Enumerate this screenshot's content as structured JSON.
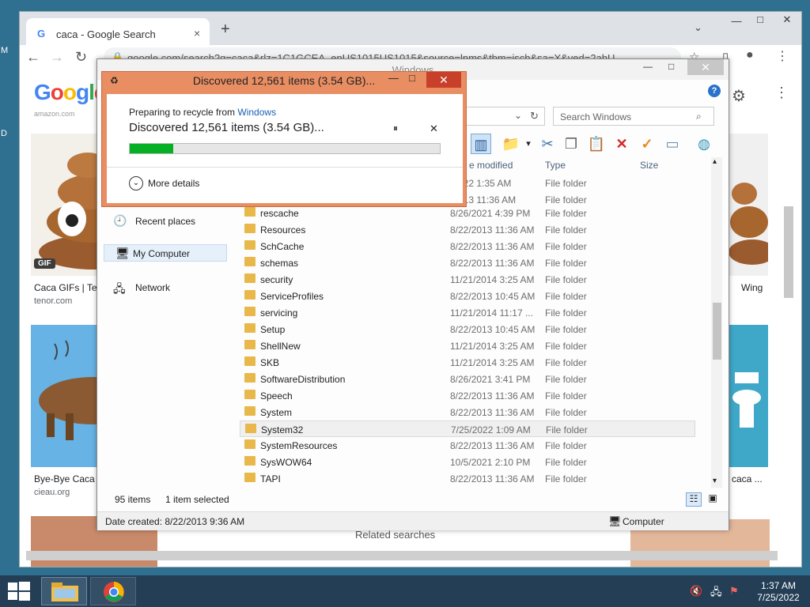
{
  "desktop": {
    "edge_m": "M",
    "edge_d": "D"
  },
  "chrome": {
    "tab_title": "caca - Google Search",
    "tab_close": "×",
    "new_tab": "+",
    "tab_menu": "⌄",
    "url": "google.com/search?q=caca&rlz=1C1GCEA_enUS1015US1015&source=lnms&tbm=isch&sa=X&ved=2ahU",
    "logo": "Google",
    "results": [
      {
        "caption": "Caca GIFs | Te",
        "source": "tenor.com",
        "badge": "GIF"
      },
      {
        "caption": "Bye-Bye Caca -",
        "source": "cieau.org"
      },
      {
        "caption": "Wing",
        "source": ""
      },
      {
        "caption": "caca ...",
        "source": ""
      }
    ],
    "related": "Related searches",
    "amazon_snip": "amazon.com"
  },
  "explorer": {
    "title": "Windows",
    "search_placeholder": "Search Windows",
    "columns": {
      "modified": "e modified",
      "type": "Type",
      "size": "Size"
    },
    "nav": [
      {
        "label": "Recent places",
        "icon": "recent-places-icon"
      },
      {
        "label": "My Computer",
        "icon": "computer-icon"
      },
      {
        "label": "Network",
        "icon": "network-icon"
      }
    ],
    "partial_rows": [
      {
        "date": "/2022 1:35 AM",
        "type": "File folder"
      },
      {
        "date": "/2013 11:36 AM",
        "type": "File folder"
      }
    ],
    "files": [
      {
        "name": "rescache",
        "date": "8/26/2021 4:39 PM",
        "type": "File folder"
      },
      {
        "name": "Resources",
        "date": "8/22/2013 11:36 AM",
        "type": "File folder"
      },
      {
        "name": "SchCache",
        "date": "8/22/2013 11:36 AM",
        "type": "File folder"
      },
      {
        "name": "schemas",
        "date": "8/22/2013 11:36 AM",
        "type": "File folder"
      },
      {
        "name": "security",
        "date": "11/21/2014 3:25 AM",
        "type": "File folder"
      },
      {
        "name": "ServiceProfiles",
        "date": "8/22/2013 10:45 AM",
        "type": "File folder"
      },
      {
        "name": "servicing",
        "date": "11/21/2014 11:17 ...",
        "type": "File folder"
      },
      {
        "name": "Setup",
        "date": "8/22/2013 10:45 AM",
        "type": "File folder"
      },
      {
        "name": "ShellNew",
        "date": "11/21/2014 3:25 AM",
        "type": "File folder"
      },
      {
        "name": "SKB",
        "date": "11/21/2014 3:25 AM",
        "type": "File folder"
      },
      {
        "name": "SoftwareDistribution",
        "date": "8/26/2021 3:41 PM",
        "type": "File folder"
      },
      {
        "name": "Speech",
        "date": "8/22/2013 11:36 AM",
        "type": "File folder"
      },
      {
        "name": "System",
        "date": "8/22/2013 11:36 AM",
        "type": "File folder"
      },
      {
        "name": "System32",
        "date": "7/25/2022 1:09 AM",
        "type": "File folder",
        "selected": true
      },
      {
        "name": "SystemResources",
        "date": "8/22/2013 11:36 AM",
        "type": "File folder"
      },
      {
        "name": "SysWOW64",
        "date": "10/5/2021 2:10 PM",
        "type": "File folder"
      },
      {
        "name": "TAPI",
        "date": "8/22/2013 11:36 AM",
        "type": "File folder"
      }
    ],
    "status": {
      "count": "95 items",
      "selected": "1 item selected"
    },
    "details": {
      "date_created": "Date created: 8/22/2013 9:36 AM",
      "location": "Computer"
    }
  },
  "dialog": {
    "title": "Discovered 12,561 items (3.54 GB)...",
    "preparing_text": "Preparing to recycle from ",
    "source_link": "Windows",
    "status": "Discovered 12,561 items (3.54 GB)...",
    "progress_fraction": 0.14,
    "more_details": "More details",
    "pause": "⏸",
    "cancel": "✕",
    "close": "✕"
  },
  "taskbar": {
    "time": "1:37 AM",
    "date": "7/25/2022"
  },
  "colors": {
    "dialog_frame": "#e98e63",
    "progress": "#06b025",
    "taskbar": "#243e56"
  }
}
